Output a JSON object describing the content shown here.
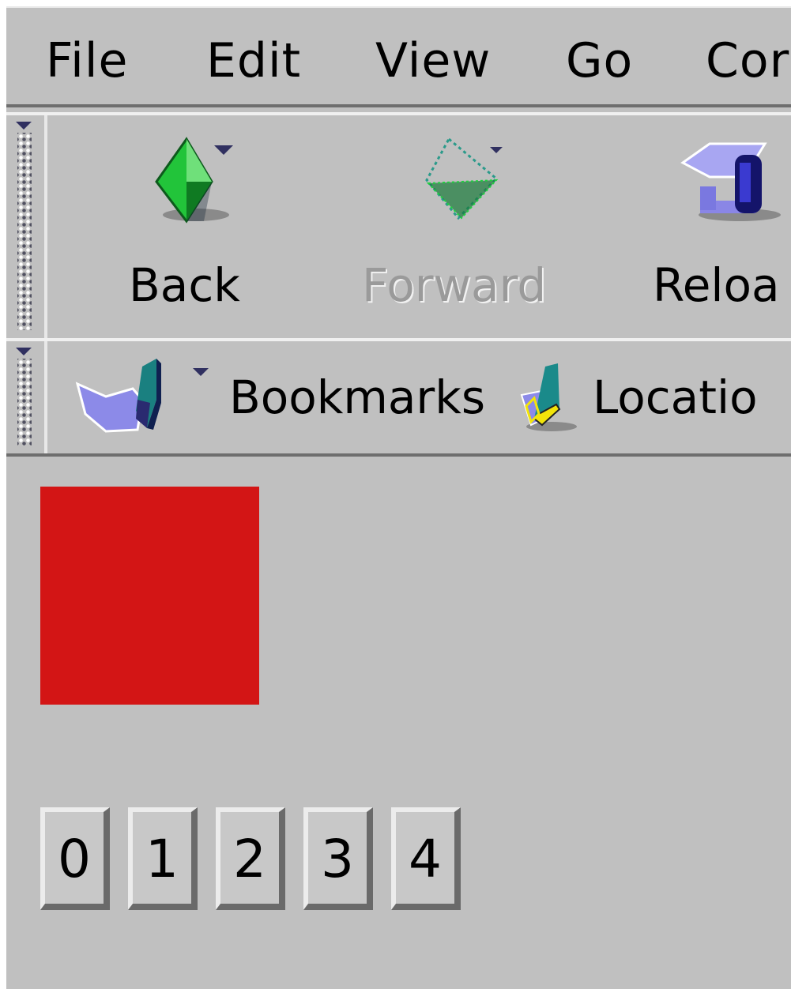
{
  "menu": {
    "items": [
      {
        "label": "File"
      },
      {
        "label": "Edit"
      },
      {
        "label": "View"
      },
      {
        "label": "Go"
      },
      {
        "label": "Cor"
      }
    ]
  },
  "navbar": {
    "back": {
      "label": "Back",
      "icon": "back-arrow-icon",
      "enabled": true
    },
    "forward": {
      "label": "Forward",
      "icon": "forward-arrow-icon",
      "enabled": false
    },
    "reload": {
      "label": "Reloa",
      "icon": "reload-icon",
      "enabled": true
    }
  },
  "personal_toolbar": {
    "bookmarks": {
      "label": "Bookmarks",
      "icon": "bookmarks-icon"
    },
    "location": {
      "label": "Locatio",
      "icon": "location-icon"
    }
  },
  "content": {
    "swatch_color": "#d31515",
    "buttons": [
      "0",
      "1",
      "2",
      "3",
      "4"
    ]
  },
  "colors": {
    "background": "#c0c0c0",
    "accent_green": "#1fae3a",
    "accent_blue": "#7a7adf"
  }
}
